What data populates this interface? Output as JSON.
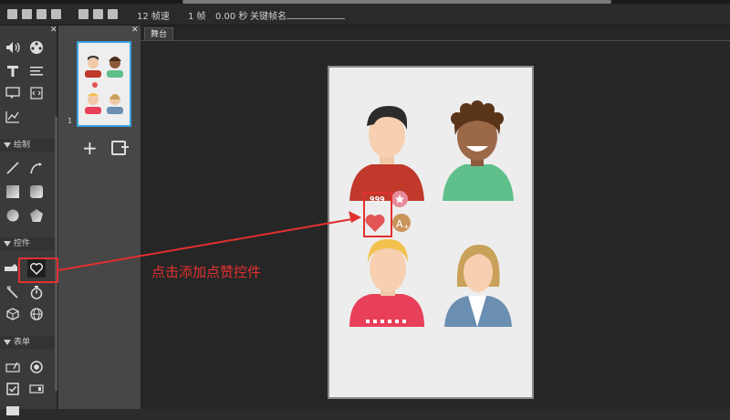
{
  "toolbar": {
    "fps": "12 帧速",
    "frames": "1 帧",
    "time": "0.00 秒",
    "keyframe_label": "关键帧名"
  },
  "tools": {
    "close": "✕",
    "draw_section": "绘制",
    "controls_section": "控件",
    "form_section": "表单"
  },
  "thumbs": {
    "close": "✕",
    "page_number": "1",
    "add": "+"
  },
  "stage": {
    "tab_label": "舞台",
    "like_count": "999"
  },
  "annotation": {
    "text": "点击添加点赞控件"
  },
  "colors": {
    "accent_red": "#e23030",
    "selection_blue": "#3ba3e0"
  }
}
